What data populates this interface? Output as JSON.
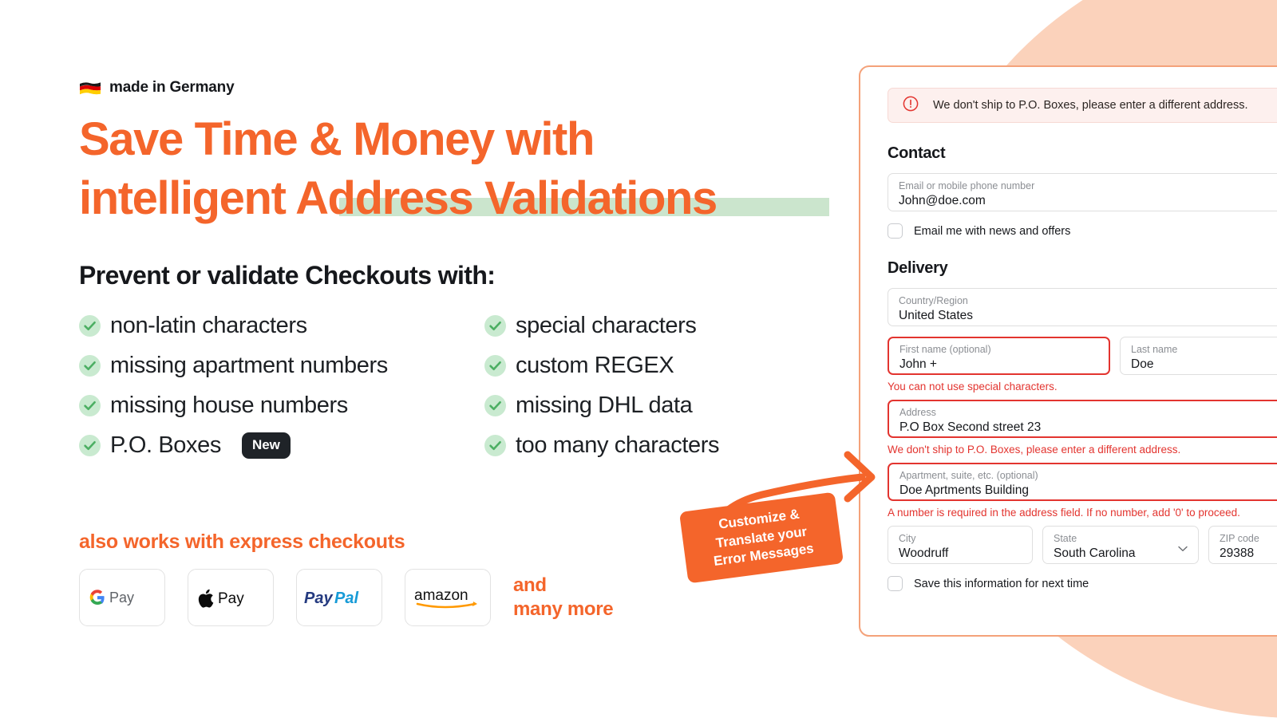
{
  "colors": {
    "brand_orange": "#f4652b",
    "peach_bg": "#fbd2bb",
    "panel_border": "#f4a27a",
    "highlight_green": "#cbe5cd",
    "check_green": "#4caf63",
    "check_bg_green": "#c9ead0",
    "error_red": "#e3342f",
    "alert_bg": "#fdf0ee",
    "dark": "#16181c"
  },
  "hero": {
    "badge_flag_icon": "german-flag-icon",
    "badge_label": "made in Germany",
    "headline_line1": "Save Time & Money with",
    "headline_line2_plain": "intelligent ",
    "headline_line2_highlight": "Address Validations",
    "subheadline": "Prevent or validate Checkouts with:"
  },
  "features": {
    "left_column": [
      {
        "label": "non-latin characters",
        "badge": null
      },
      {
        "label": "missing apartment numbers",
        "badge": null
      },
      {
        "label": "missing house numbers",
        "badge": null
      },
      {
        "label": "P.O. Boxes",
        "badge": "New"
      }
    ],
    "right_column": [
      {
        "label": "special characters",
        "badge": null
      },
      {
        "label": "custom REGEX",
        "badge": null
      },
      {
        "label": "missing DHL data",
        "badge": null
      },
      {
        "label": "too many characters",
        "badge": null
      }
    ]
  },
  "express": {
    "label": "also works with express checkouts",
    "logos": [
      {
        "name": "google-pay-logo",
        "text": "Pay"
      },
      {
        "name": "apple-pay-logo",
        "text": "Pay"
      },
      {
        "name": "paypal-logo",
        "text_bold": "Pay",
        "text_light": "Pal"
      },
      {
        "name": "amazon-logo",
        "text": "amazon"
      }
    ],
    "and_many_more_line1": "and",
    "and_many_more_line2": "many more"
  },
  "callout": {
    "line1": "Customize &",
    "line2": "Translate your",
    "line3": "Error Messages",
    "arrow_icon": "curved-arrow-icon"
  },
  "checkout": {
    "alert": {
      "icon": "error-circle-icon",
      "message": "We don't ship to P.O. Boxes, please enter a different address."
    },
    "contact": {
      "title": "Contact",
      "email_label": "Email or mobile phone number",
      "email_value": "John@doe.com",
      "newsletter_checkbox_label": "Email me with news and offers"
    },
    "delivery": {
      "title": "Delivery",
      "country_label": "Country/Region",
      "country_value": "United States",
      "first_name_label": "First name (optional)",
      "first_name_value": "John +",
      "first_name_error": "You can not use special characters.",
      "last_name_label": "Last name",
      "last_name_value": "Doe",
      "address_label": "Address",
      "address_value": "P.O Box Second street 23",
      "address_error": "We don't ship to P.O. Boxes, please enter a different address.",
      "apartment_label": "Apartment, suite, etc. (optional)",
      "apartment_value": "Doe Aprtments Building",
      "apartment_error": "A number is required in the address field. If no number, add '0' to proceed.",
      "city_label": "City",
      "city_value": "Woodruff",
      "state_label": "State",
      "state_value": "South Carolina",
      "state_chevron_icon": "chevron-down-icon",
      "zip_label": "ZIP code",
      "zip_value": "29388",
      "save_checkbox_label": "Save this information for next time"
    }
  }
}
